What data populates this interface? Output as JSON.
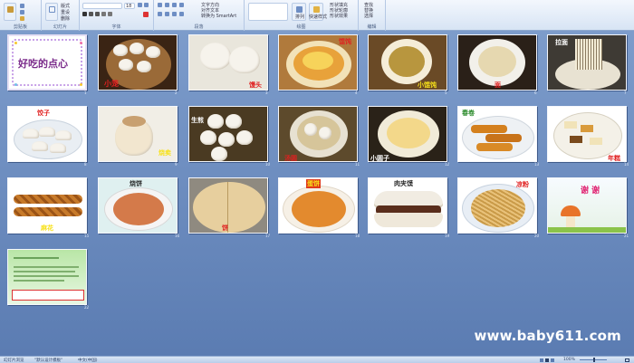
{
  "ribbon": {
    "groups": [
      {
        "label": "剪贴板"
      },
      {
        "label": "幻灯片"
      },
      {
        "label": "字体"
      },
      {
        "label": "段落"
      },
      {
        "label": "绘图"
      },
      {
        "label": "编辑"
      }
    ],
    "buttons": {
      "new_slide": "新建\n幻灯片",
      "layout": "版式",
      "reset": "重设",
      "delete": "删除",
      "font_size": "18",
      "font_name": "",
      "text_direction": "文字方向",
      "align_text": "对齐文本",
      "smartart": "转换为 SmartArt",
      "arrange": "排列",
      "quick_styles": "快速样式",
      "shape_fill": "形状填充",
      "shape_outline": "形状轮廓",
      "shape_effect": "形状效果",
      "find": "查找",
      "replace": "替换",
      "select": "选择"
    }
  },
  "slides": [
    {
      "num": "1",
      "title": "好吃的点心",
      "label": ""
    },
    {
      "num": "2",
      "label": "小笼"
    },
    {
      "num": "3",
      "label": "馒头"
    },
    {
      "num": "4",
      "label": "馄饨"
    },
    {
      "num": "5",
      "label": "小馄饨"
    },
    {
      "num": "6",
      "label": "面"
    },
    {
      "num": "7",
      "label": "拉面"
    },
    {
      "num": "8",
      "label": "饺子"
    },
    {
      "num": "9",
      "label": "烧卖"
    },
    {
      "num": "10",
      "label": "生煎"
    },
    {
      "num": "11",
      "label": "汤圆"
    },
    {
      "num": "12",
      "label": "小圆子"
    },
    {
      "num": "13",
      "label": "春卷"
    },
    {
      "num": "14",
      "label": "年糕"
    },
    {
      "num": "15",
      "label": "麻花"
    },
    {
      "num": "16",
      "label": "烧饼"
    },
    {
      "num": "17",
      "label": "饼"
    },
    {
      "num": "18",
      "label": "蛋饼"
    },
    {
      "num": "19",
      "label": "肉夹馍"
    },
    {
      "num": "20",
      "label": "凉粉"
    },
    {
      "num": "21",
      "label": "谢 谢"
    },
    {
      "num": "22",
      "label": ""
    }
  ],
  "watermark": "www.baby611.com",
  "status": {
    "view": "幻灯片浏览",
    "theme": "\"默认设计模板\"",
    "language": "中文(中国)",
    "zoom": "100%"
  },
  "colors": {
    "accent_red": "#e02020",
    "accent_yellow": "#f7e11a",
    "sorter_bg": "#6f8fbf",
    "ribbon_bg": "#dbe6f5"
  }
}
